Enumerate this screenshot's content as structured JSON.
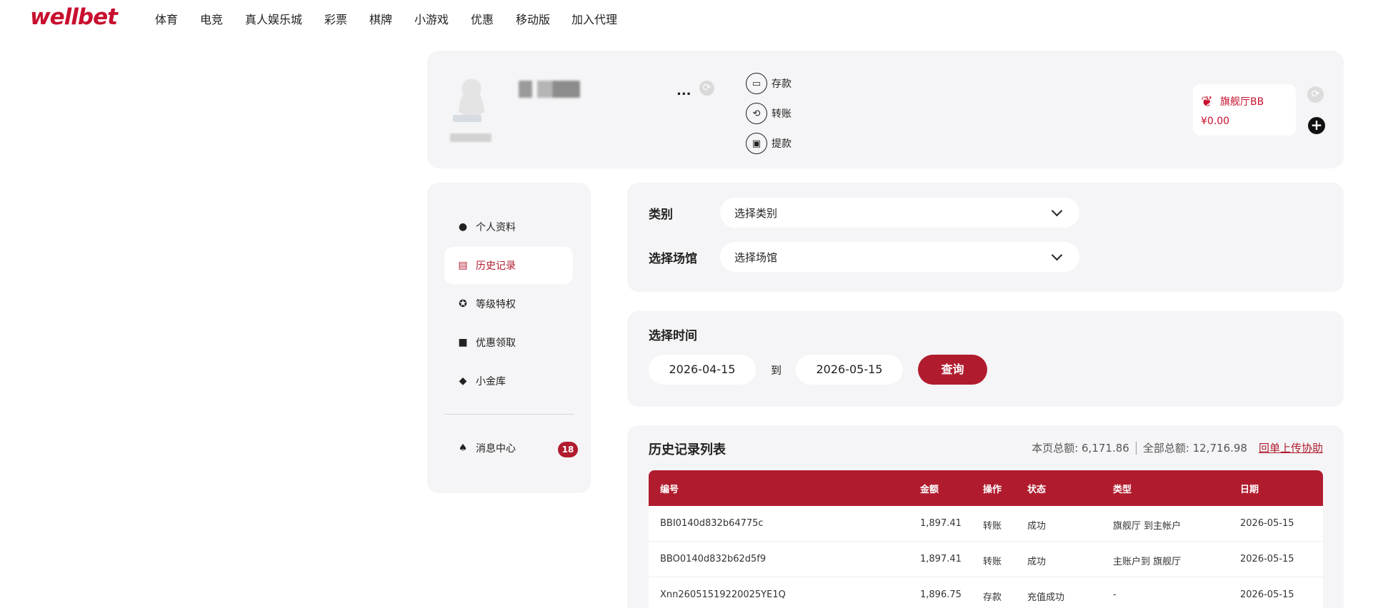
{
  "header": {
    "logo": "wellbet",
    "nav": [
      "体育",
      "电竞",
      "真人娱乐城",
      "彩票",
      "棋牌",
      "小游戏",
      "优惠",
      "移动版",
      "加入代理"
    ]
  },
  "account": {
    "balance_masked": "...",
    "actions": [
      {
        "label": "存款",
        "icon": "deposit-icon"
      },
      {
        "label": "转账",
        "icon": "transfer-icon"
      },
      {
        "label": "提款",
        "icon": "withdraw-icon"
      }
    ],
    "venue": {
      "name": "旗舰厅BB",
      "balance": "¥0.00"
    }
  },
  "sidebar": {
    "items": [
      {
        "label": "个人资料",
        "icon": "user-icon"
      },
      {
        "label": "历史记录",
        "icon": "history-icon",
        "active": true
      },
      {
        "label": "等级特权",
        "icon": "medal-icon"
      },
      {
        "label": "优惠领取",
        "icon": "gift-icon"
      },
      {
        "label": "小金库",
        "icon": "diamond-icon"
      }
    ],
    "messages": {
      "label": "消息中心",
      "count": "18"
    }
  },
  "filters": {
    "category_label": "类别",
    "category_value": "选择类别",
    "venue_label": "选择场馆",
    "venue_value": "选择场馆"
  },
  "time": {
    "title": "选择时间",
    "start": "2026-04-15",
    "to": "到",
    "end": "2026-05-15",
    "query": "查询"
  },
  "history": {
    "title": "历史记录列表",
    "page_total": "本页总额: 6,171.86",
    "all_total": "全部总额: 12,716.98",
    "upload_link": "回单上传协助",
    "columns": [
      "编号",
      "金额",
      "操作",
      "状态",
      "类型",
      "日期"
    ],
    "rows": [
      [
        "BBI0140d832b64775c",
        "1,897.41",
        "转账",
        "成功",
        "旗舰厅 到主帐户",
        "2026-05-15"
      ],
      [
        "BBO0140d832b62d5f9",
        "1,897.41",
        "转账",
        "成功",
        "主账户到 旗舰厅",
        "2026-05-15"
      ],
      [
        "Xnn26051519220025YE1Q",
        "1,896.75",
        "存款",
        "充值成功",
        "-",
        "2026-05-15"
      ]
    ]
  },
  "colors": {
    "brand": "#b01c2e",
    "panel": "#f5f5f7"
  }
}
